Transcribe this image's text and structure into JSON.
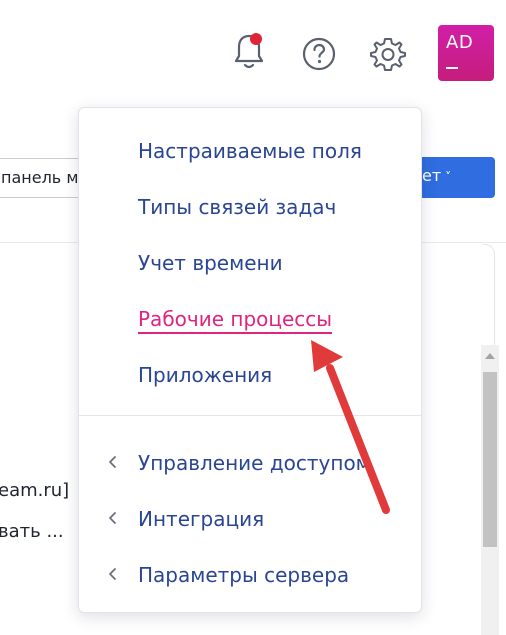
{
  "header": {
    "notifications_icon": "bell-icon",
    "notification_dot_color": "#e02436",
    "help_icon": "question-circle-icon",
    "settings_icon": "gear-icon",
    "avatar_initials": "AD",
    "avatar_color": "#c51d7c"
  },
  "background": {
    "input_text": "панель м",
    "button_label": "ет",
    "button_color": "#2f6de0",
    "text_line_1": "eam.ru]",
    "text_line_2": "вать ..."
  },
  "menu": {
    "items": [
      {
        "label": "Настраиваемые поля",
        "active": false
      },
      {
        "label": "Типы связей задач",
        "active": false
      },
      {
        "label": "Учет времени",
        "active": false
      },
      {
        "label": "Рабочие процессы",
        "active": true
      },
      {
        "label": "Приложения",
        "active": false
      }
    ],
    "submenus": [
      {
        "label": "Управление доступом",
        "icon": "chevron-left-icon"
      },
      {
        "label": "Интеграция",
        "icon": "chevron-left-icon"
      },
      {
        "label": "Параметры сервера",
        "icon": "chevron-left-icon"
      }
    ],
    "link_color": "#2a4693",
    "active_color": "#e0247f"
  },
  "annotation": {
    "arrow_color": "#e03a3a"
  }
}
